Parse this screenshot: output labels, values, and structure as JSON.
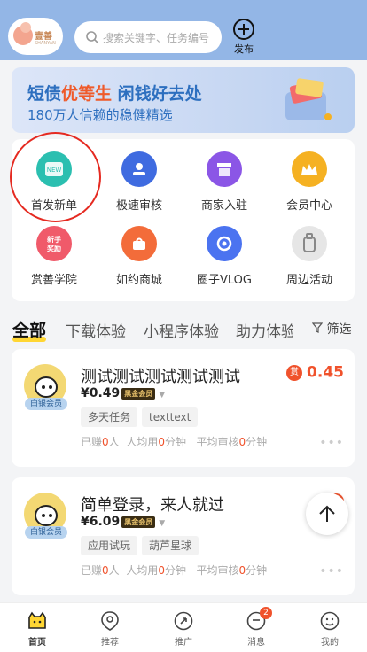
{
  "header": {
    "logo_text": "壹善",
    "logo_sub": "SHANYAN",
    "search_placeholder": "搜索关键字、任务编号",
    "publish_label": "发布"
  },
  "banner": {
    "line1_prefix": "短债",
    "line1_highlight": "优等生",
    "line1_suffix": " 闲钱好去处",
    "line2": "180万人信赖的稳健精选"
  },
  "categories": [
    {
      "label": "首发新单",
      "icon": "new-order-icon",
      "color": "#2bbfb0"
    },
    {
      "label": "极速审核",
      "icon": "fast-review-icon",
      "color": "#3f6be0"
    },
    {
      "label": "商家入驻",
      "icon": "shop-icon",
      "color": "#8b56e6"
    },
    {
      "label": "会员中心",
      "icon": "crown-icon",
      "color": "#f5b122"
    },
    {
      "label": "赏善学院",
      "icon": "academy-icon",
      "color": "#f05a6a",
      "badge": "新手奖励"
    },
    {
      "label": "如约商城",
      "icon": "mall-icon",
      "color": "#f36c3a"
    },
    {
      "label": "圈子VLOG",
      "icon": "vlog-icon",
      "color": "#4b73f0"
    },
    {
      "label": "周边活动",
      "icon": "activity-icon",
      "color": "#bbbbbb"
    }
  ],
  "tabs": {
    "items": [
      "全部",
      "下载体验",
      "小程序体验",
      "助力体验"
    ],
    "active": "全部",
    "filter_label": "筛选"
  },
  "tasks": [
    {
      "title": "测试测试测试测试测试",
      "price": "¥0.49",
      "price_tag": "黑金会员",
      "member": "白银会员",
      "tags": [
        "多天任务",
        "texttext"
      ],
      "earned": "0",
      "avg_time": "0",
      "review_time": "0",
      "reward_badge": "赏",
      "reward": "0.45"
    },
    {
      "title": "简单登录，来人就过",
      "price": "¥6.09",
      "price_tag": "黑金会员",
      "member": "白银会员",
      "tags": [
        "应用试玩",
        "葫芦星球"
      ],
      "earned": "0",
      "avg_time": "0",
      "review_time": "0",
      "reward_badge": "赏",
      "reward": ""
    }
  ],
  "stats_labels": {
    "earned_prefix": "已赚",
    "earned_suffix": "人",
    "avg_prefix": "人均用",
    "avg_suffix": "分钟",
    "review_prefix": "平均审核",
    "review_suffix": "分钟"
  },
  "bottom_nav": [
    {
      "label": "首页",
      "icon": "home-icon"
    },
    {
      "label": "推荐",
      "icon": "recommend-icon"
    },
    {
      "label": "推广",
      "icon": "promote-icon"
    },
    {
      "label": "消息",
      "icon": "message-icon",
      "badge": "2"
    },
    {
      "label": "我的",
      "icon": "profile-icon"
    }
  ],
  "colors": {
    "header_bg": "#93b6e6",
    "accent_orange": "#f0522c",
    "tab_underline": "#ffd633"
  }
}
